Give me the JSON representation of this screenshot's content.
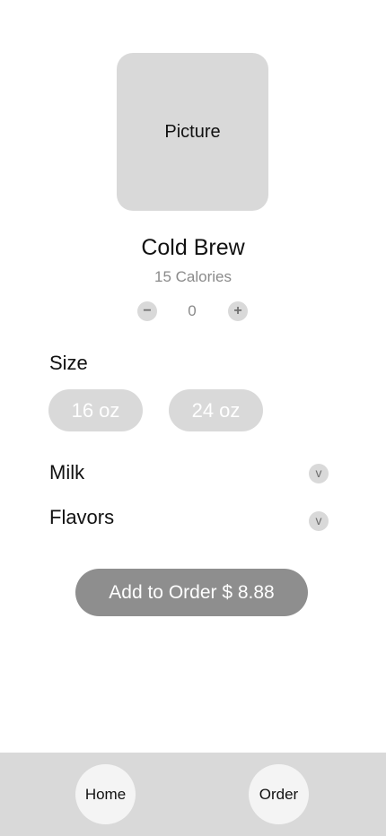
{
  "product": {
    "picture_label": "Picture",
    "name": "Cold Brew",
    "calories": "15 Calories"
  },
  "quantity": {
    "minus_label": "−",
    "value": "0",
    "plus_label": "+"
  },
  "size": {
    "heading": "Size",
    "options": [
      "16 oz",
      "24 oz"
    ]
  },
  "options": {
    "milk_label": "Milk",
    "flavors_label": "Flavors",
    "expand_glyph": "v"
  },
  "cta": {
    "add_to_order_label": "Add to Order $ 8.88"
  },
  "nav": {
    "home_label": "Home",
    "order_label": "Order"
  },
  "colors": {
    "placeholder": "#d9d9d9",
    "cta": "#8e8e8e",
    "muted_text": "#8a8a8a",
    "nav_button": "#f4f4f4"
  }
}
